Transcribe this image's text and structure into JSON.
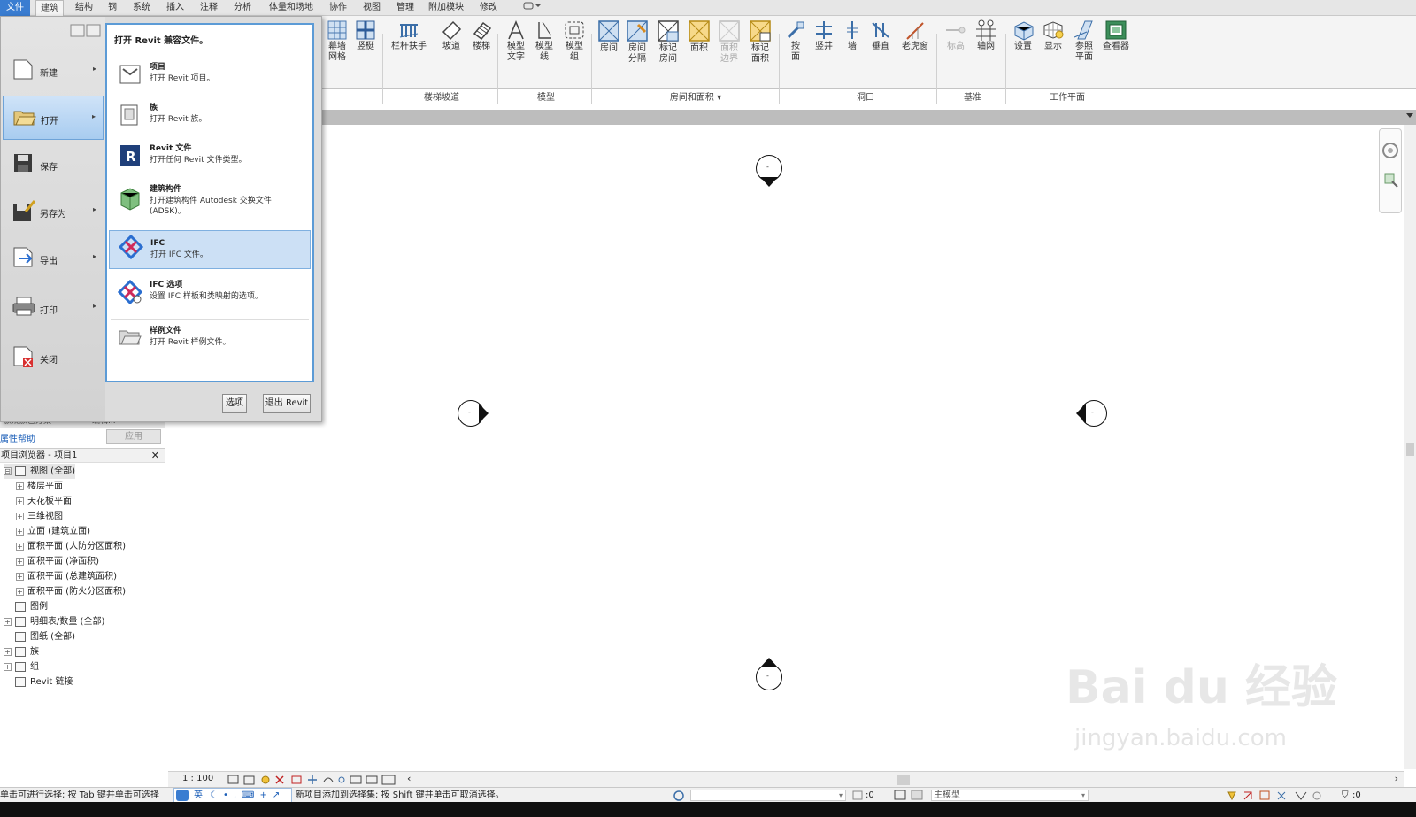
{
  "ribbon_tabs": [
    "文件",
    "建筑",
    "结构",
    "钢",
    "系统",
    "插入",
    "注释",
    "分析",
    "体量和场地",
    "协作",
    "视图",
    "管理",
    "附加模块",
    "修改"
  ],
  "ribbon_tools": {
    "curtain_grid": "幕墙\n网格",
    "mullion": "竖梃",
    "railing": "栏杆扶手",
    "ramp": "坡道",
    "stair": "楼梯",
    "model_text": "模型\n文字",
    "model_line": "模型\n线",
    "model_group": "模型\n组",
    "room": "房间",
    "room_sep": "房间\n分隔",
    "tag_room": "标记\n房间",
    "area": "面积",
    "area_boundary": "面积\n边界",
    "tag_area": "标记\n面积",
    "by_face": "按\n面",
    "shaft": "竖井",
    "wall": "墙",
    "vertical": "垂直",
    "dormer": "老虎窗",
    "level": "标高",
    "grid": "轴网",
    "set": "设置",
    "show": "显示",
    "ref_plane": "参照\n平面",
    "viewer": "查看器"
  },
  "ribbon_panels": [
    "楼梯坡道",
    "模型",
    "房间和面积 ▾",
    "洞口",
    "基准",
    "工作平面"
  ],
  "app_menu": {
    "commands": [
      {
        "label": "新建",
        "arrow": "▸"
      },
      {
        "label": "打开",
        "arrow": "▸"
      },
      {
        "label": "保存",
        "arrow": ""
      },
      {
        "label": "另存为",
        "arrow": "▸"
      },
      {
        "label": "导出",
        "arrow": "▸"
      },
      {
        "label": "打印",
        "arrow": "▸"
      },
      {
        "label": "关闭",
        "arrow": ""
      }
    ],
    "submenu_header": "打开 Revit 兼容文件。",
    "submenu_items": [
      {
        "title": "项目",
        "desc": "打开 Revit 项目。"
      },
      {
        "title": "族",
        "desc": "打开 Revit 族。"
      },
      {
        "title": "Revit 文件",
        "desc": "打开任何 Revit 文件类型。"
      },
      {
        "title": "建筑构件",
        "desc": "打开建筑构件 Autodesk 交换文件 (ADSK)。"
      },
      {
        "title": "IFC",
        "desc": "打开 IFC 文件。"
      },
      {
        "title": "IFC 选项",
        "desc": "设置 IFC 样板和类映射的选项。"
      },
      {
        "title": "样例文件",
        "desc": "打开 Revit 样例文件。"
      }
    ],
    "options_button": "选项",
    "exit_button": "退出 Revit"
  },
  "properties": {
    "help_link": "属性帮助",
    "apply_button": "应用",
    "partial_left": "族规族已方案",
    "partial_edit": "编辑..."
  },
  "project_browser": {
    "title": "项目浏览器 - 项目1",
    "close": "✕",
    "items": [
      {
        "label": "视图 (全部)",
        "level": 0,
        "expand": "⊟"
      },
      {
        "label": "楼层平面",
        "level": 1,
        "expand": "+"
      },
      {
        "label": "天花板平面",
        "level": 1,
        "expand": "+"
      },
      {
        "label": "三维视图",
        "level": 1,
        "expand": "+"
      },
      {
        "label": "立面 (建筑立面)",
        "level": 1,
        "expand": "+"
      },
      {
        "label": "面积平面 (人防分区面积)",
        "level": 1,
        "expand": "+"
      },
      {
        "label": "面积平面 (净面积)",
        "level": 1,
        "expand": "+"
      },
      {
        "label": "面积平面 (总建筑面积)",
        "level": 1,
        "expand": "+"
      },
      {
        "label": "面积平面 (防火分区面积)",
        "level": 1,
        "expand": "+"
      },
      {
        "label": "图例",
        "level": 0,
        "expand": ""
      },
      {
        "label": "明细表/数量 (全部)",
        "level": 0,
        "expand": "+"
      },
      {
        "label": "图纸 (全部)",
        "level": 0,
        "expand": ""
      },
      {
        "label": "族",
        "level": 0,
        "expand": "+"
      },
      {
        "label": "组",
        "level": 0,
        "expand": "+"
      },
      {
        "label": "Revit 链接",
        "level": 0,
        "expand": ""
      }
    ]
  },
  "view_control": {
    "scale": "1 : 100"
  },
  "status": {
    "left_text": "单击可进行选择; 按 Tab 键并单击可选择",
    "right_text": "新项目添加到选择集; 按 Shift 键并单击可取消选择。",
    "ime_lang": "英",
    "zero_a": ":0",
    "main_model": "主模型",
    "filter_count": ":0"
  },
  "drawing": {
    "bubble_mark": "-"
  },
  "watermark": {
    "brand": "Bai du 经验",
    "url": "jingyan.baidu.com"
  }
}
